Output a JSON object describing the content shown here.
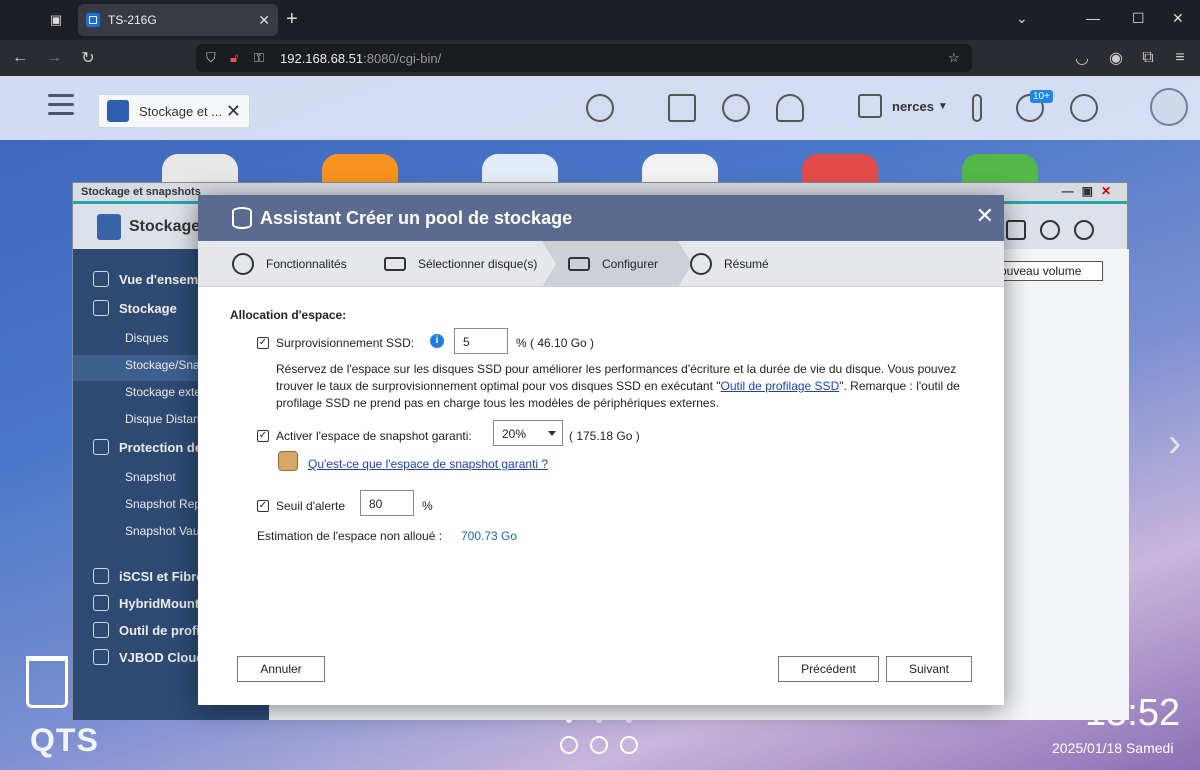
{
  "browser": {
    "tab_title": "TS-216G",
    "url_host": "192.168.68.51",
    "url_rest": ":8080/cgi-bin/"
  },
  "desktop": {
    "qts_tab_label": "Stockage et ...",
    "user_name": "nerces",
    "notification_badge": "10+",
    "clock": "15:52",
    "date": "2025/01/18 Samedi",
    "logo": "QTS"
  },
  "bg_window": {
    "title": "Stockage et snapshots",
    "header_title": "Stockage e",
    "new_volume_button": "ouveau volume",
    "sidebar": {
      "overview": "Vue d'ensemb",
      "storage": "Stockage",
      "disks": "Disques",
      "storage_snapshots": "Stockage/Sna",
      "external_storage": "Stockage exte",
      "remote_disk": "Disque Distan",
      "protection": "Protection des",
      "snapshot": "Snapshot",
      "snapshot_replica": "Snapshot Rep",
      "snapshot_vault": "Snapshot Vau",
      "iscsi": "iSCSI et Fibre",
      "hybridmount": "HybridMount",
      "ssd_profiling": "Outil de profila",
      "vjbod": "VJBOD Cloud"
    }
  },
  "dialog": {
    "title": "Assistant Créer un pool de stockage",
    "steps": [
      "Fonctionnalités",
      "Sélectionner disque(s)",
      "Configurer",
      "Résumé"
    ],
    "section_title": "Allocation d'espace:",
    "ssd_overprov": {
      "label": "Surprovisionnement SSD:",
      "value": "5",
      "suffix": "% ( 46.10 Go )",
      "desc_before": "Réservez de l'espace sur les disques SSD pour améliorer les performances d'écriture et la durée de vie du disque. Vous pouvez trouver le taux de surprovisionnement optimal pour vos disques SSD en exécutant \"",
      "desc_link": "Outil de profilage SSD",
      "desc_after": "\". Remarque : l'outil de profilage SSD ne prend pas en charge tous les modèles de périphériques externes."
    },
    "snapshot_space": {
      "label": "Activer l'espace de snapshot garanti:",
      "selected": "20%",
      "suffix": "( 175.18 Go )",
      "help_link": "Qu'est-ce que l'espace de snapshot garanti ?"
    },
    "alert_threshold": {
      "label": "Seuil d'alerte",
      "value": "80",
      "suffix": "%"
    },
    "unallocated": {
      "label": "Estimation de l'espace non alloué :",
      "value": "700.73 Go"
    },
    "buttons": {
      "cancel": "Annuler",
      "previous": "Précédent",
      "next": "Suivant"
    }
  },
  "colors": {
    "dialog_header": "#5b6a8f",
    "link": "#1a3fc4",
    "value_blue": "#1a66c6"
  }
}
